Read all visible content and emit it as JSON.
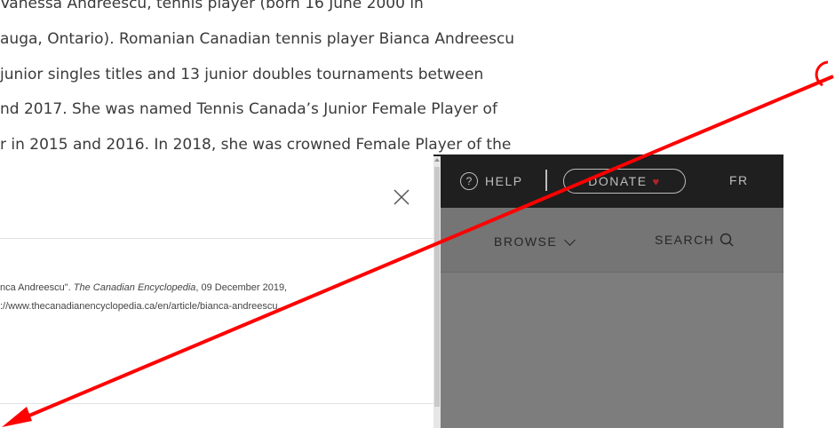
{
  "article": {
    "lines": [
      "Vanessa Andreescu, tennis player (born 16 June 2000 in",
      "auga, Ontario). Romanian Canadian tennis player Bianca Andreescu",
      "junior singles titles and 13 junior doubles tournaments between",
      "nd 2017. She was named Tennis Canada’s Junior Female Player of",
      "r in 2015 and 2016. In 2018, she was crowned Female Player of the"
    ]
  },
  "header": {
    "help_icon": "?",
    "help_label": "HELP",
    "donate_label": "DONATE",
    "donate_icon": "heart-icon",
    "lang_label": "FR",
    "browse_label": "BROWSE",
    "search_label": "SEARCH"
  },
  "modal": {
    "close_icon": "close-icon",
    "citation_line1_a": "nca Andreescu\". ",
    "citation_line1_italic": "The Canadian Encyclopedia",
    "citation_line1_b": ", 09 December 2019,",
    "citation_line2": "://www.thecanadianencyclopedia.ca/en/article/bianca-andreescu."
  },
  "colors": {
    "topbar": "#1f1f1f",
    "subbar": "#757575",
    "arrow": "#ff0000",
    "heart": "#b3232b"
  }
}
